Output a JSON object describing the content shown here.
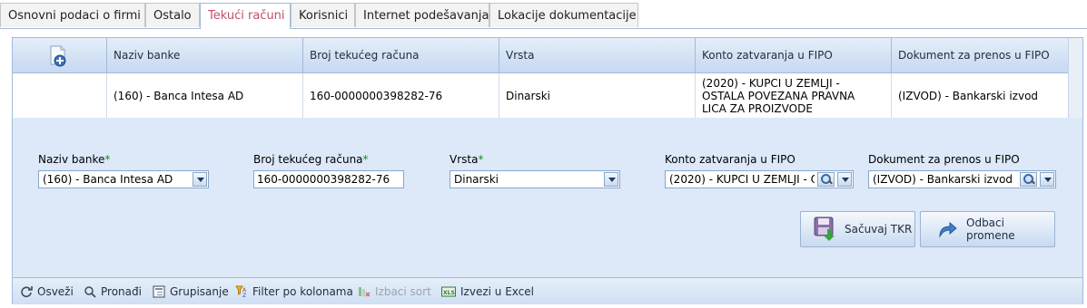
{
  "tabs": [
    {
      "label": "Osnovni podaci o firmi",
      "active": false
    },
    {
      "label": "Ostalo",
      "active": false
    },
    {
      "label": "Tekući računi",
      "active": true
    },
    {
      "label": "Korisnici",
      "active": false
    },
    {
      "label": "Internet podešavanja",
      "active": false
    },
    {
      "label": "Lokacije dokumentacije",
      "active": false
    }
  ],
  "grid": {
    "columns": [
      "Naziv banke",
      "Broj tekućeg računa",
      "Vrsta",
      "Konto zatvaranja u FIPO",
      "Dokument za prenos u FIPO"
    ],
    "rows": [
      [
        "(160) - Banca Intesa AD",
        "160-0000000398282-76",
        "Dinarski",
        "(2020) - KUPCI U ZEMLJI - OSTALA POVEZANA PRAVNA LICA ZA PROIZVODE",
        "(IZVOD) - Bankarski izvod"
      ]
    ]
  },
  "form": {
    "naziv_banke": {
      "label": "Naziv banke",
      "value": "(160) - Banca Intesa AD"
    },
    "broj_racuna": {
      "label": "Broj tekućeg računa",
      "value": "160-0000000398282-76"
    },
    "vrsta": {
      "label": "Vrsta",
      "value": "Dinarski"
    },
    "konto": {
      "label": "Konto zatvaranja u FIPO",
      "value": "(2020) - KUPCI U ZEMLJI - OSTALA POVEZANA PRAVNA LICA ZA PROIZVODE"
    },
    "dokument": {
      "label": "Dokument za prenos u FIPO",
      "value": "(IZVOD) - Bankarski izvod"
    },
    "required_mark": "*",
    "save_label": "Sačuvaj TKR",
    "discard_label": "Odbaci promene"
  },
  "toolbar": {
    "refresh": "Osveži",
    "find": "Pronađi",
    "group": "Grupisanje",
    "filter": "Filter po kolonama",
    "clear_sort": "Izbaci sort",
    "export": "Izvezi u Excel"
  },
  "colors": {
    "active_tab": "#c0506a",
    "required": "#1a8a1a",
    "header": "#c6d9f1"
  }
}
